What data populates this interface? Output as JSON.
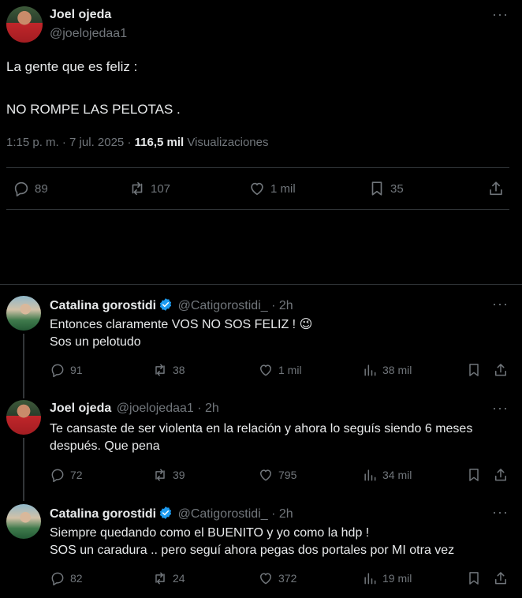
{
  "main_tweet": {
    "author_name": "Joel ojeda",
    "author_handle": "@joelojedaa1",
    "text_line1": "La gente que es feliz :",
    "text_line2": "NO ROMPE LAS PELOTAS .",
    "time": "1:15 p. m.",
    "date": "7 jul. 2025",
    "views_count": "116,5 mil",
    "views_label": "Visualizaciones",
    "replies": "89",
    "reposts": "107",
    "likes": "1 mil",
    "bookmarks": "35"
  },
  "replies": [
    {
      "author_name": "Catalina gorostidi",
      "author_handle": "@Catigorostidi_",
      "time": "2h",
      "verified": true,
      "line1": "Entonces claramente VOS NO SOS FELIZ ! 😉",
      "line2": "Sos un pelotudo",
      "replies": "91",
      "reposts": "38",
      "likes": "1 mil",
      "views": "38 mil"
    },
    {
      "author_name": "Joel ojeda",
      "author_handle": "@joelojedaa1",
      "time": "2h",
      "verified": false,
      "line1": "Te cansaste de ser violenta en la relación y ahora lo seguís siendo 6 meses",
      "line2": "después. Que pena",
      "replies": "72",
      "reposts": "39",
      "likes": "795",
      "views": "34 mil"
    },
    {
      "author_name": "Catalina gorostidi",
      "author_handle": "@Catigorostidi_",
      "time": "2h",
      "verified": true,
      "line1": "Siempre quedando como el BUENITO y yo como la hdp !",
      "line2": "SOS un caradura .. pero seguí ahora pegas dos portales por MI otra vez",
      "replies": "82",
      "reposts": "24",
      "likes": "372",
      "views": "19 mil"
    }
  ],
  "colors": {
    "background": "#000000",
    "text": "#e7e9ea",
    "muted": "#71767b",
    "divider": "#2f3336",
    "verified": "#1d9bf0"
  }
}
